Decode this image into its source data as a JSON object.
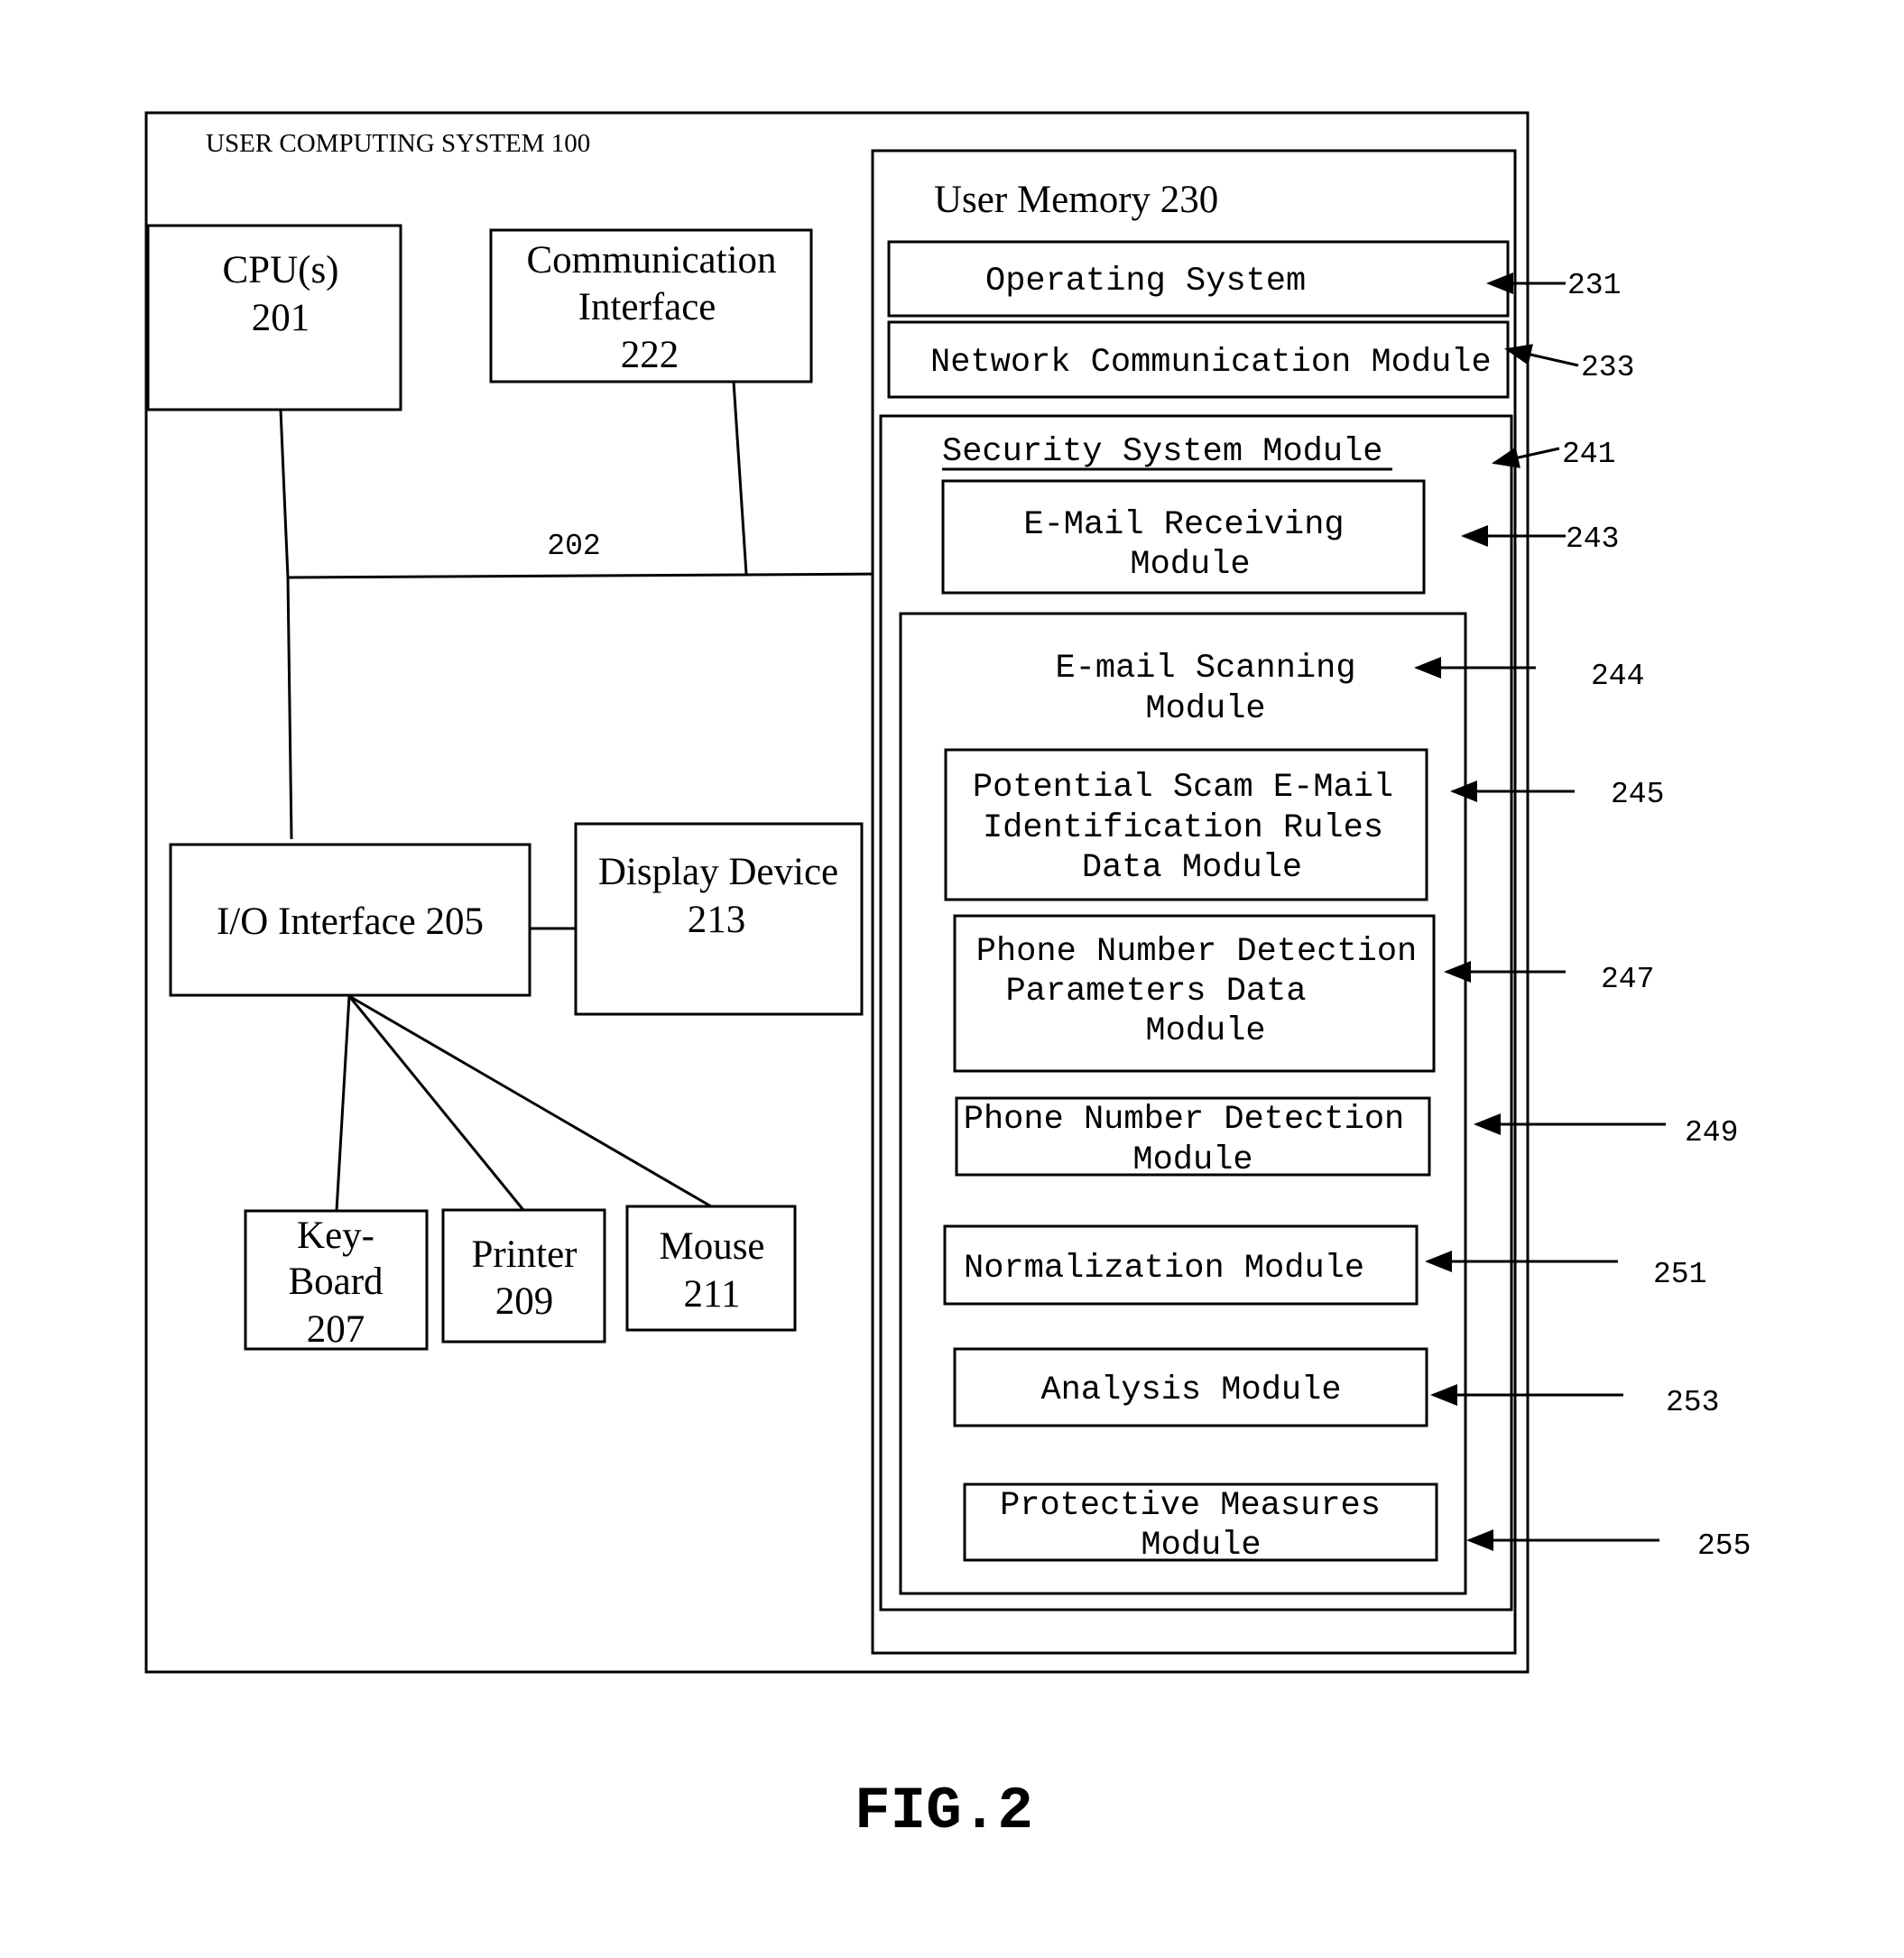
{
  "figure_label": "FIG.2",
  "system": {
    "title": "USER COMPUTING SYSTEM 100",
    "bus_label": "202"
  },
  "hardware": {
    "cpu": {
      "line1": "CPU(s)",
      "line2": "201"
    },
    "comm": {
      "line1": "Communication",
      "line2": "Interface",
      "line3": "222"
    },
    "io": {
      "label": "I/O Interface 205"
    },
    "display": {
      "line1": "Display Device",
      "line2": "213"
    },
    "keyboard": {
      "line1": "Key-",
      "line2": "Board",
      "line3": "207"
    },
    "printer": {
      "line1": "Printer",
      "line2": "209"
    },
    "mouse": {
      "line1": "Mouse",
      "line2": "211"
    }
  },
  "memory": {
    "title": "User Memory 230",
    "operating_system": {
      "label": "Operating System",
      "ref": "231"
    },
    "network_module": {
      "label": "Network Communication Module",
      "ref": "233"
    },
    "security": {
      "title": "Security System Module",
      "ref": "241",
      "email_receiving": {
        "line1": "E-Mail Receiving",
        "line2": "Module",
        "ref": "243"
      },
      "email_scanning": {
        "line1": "E-mail Scanning",
        "line2": "Module",
        "ref": "244",
        "rules": {
          "line1": "Potential Scam E-Mail",
          "line2": "Identification Rules",
          "line3": "Data Module",
          "ref": "245"
        },
        "params": {
          "line1": "Phone Number Detection",
          "line2": "Parameters Data",
          "line3": "Module",
          "ref": "247"
        },
        "detection": {
          "line1": "Phone Number Detection",
          "line2": "Module",
          "ref": "249"
        },
        "normalization": {
          "label": "Normalization Module",
          "ref": "251"
        },
        "analysis": {
          "label": "Analysis Module",
          "ref": "253"
        },
        "protective": {
          "line1": "Protective Measures",
          "line2": "Module",
          "ref": "255"
        }
      }
    }
  }
}
